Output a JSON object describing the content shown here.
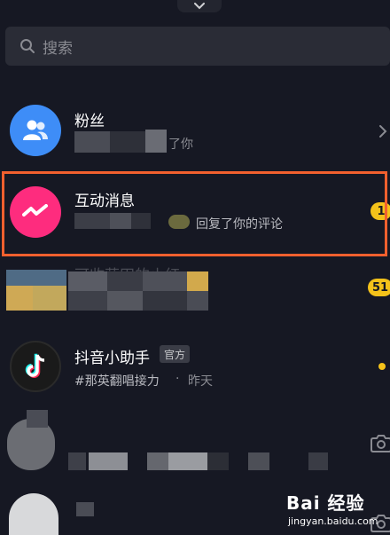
{
  "search": {
    "placeholder": "搜索"
  },
  "rows": {
    "fans": {
      "title": "粉丝",
      "subtitle_tail": "了你"
    },
    "interactions": {
      "title": "互动消息",
      "subtitle_tail": "回复了你的评论",
      "badge": "1"
    },
    "row3": {
      "title_fragment": "可收获田的小红",
      "badge": "51"
    },
    "assistant": {
      "title": "抖音小助手",
      "tag": "官方",
      "subtitle": "#那英翻唱接力",
      "time": "昨天"
    }
  },
  "watermark": {
    "text": "Bai 经验",
    "url": "jingyan.baidu.com"
  },
  "colors": {
    "background": "#161823",
    "highlight": "#f2602e",
    "badge": "#f4c21a",
    "fans_avatar": "#3e8df7",
    "interaction_avatar": "#fe2c7e"
  }
}
